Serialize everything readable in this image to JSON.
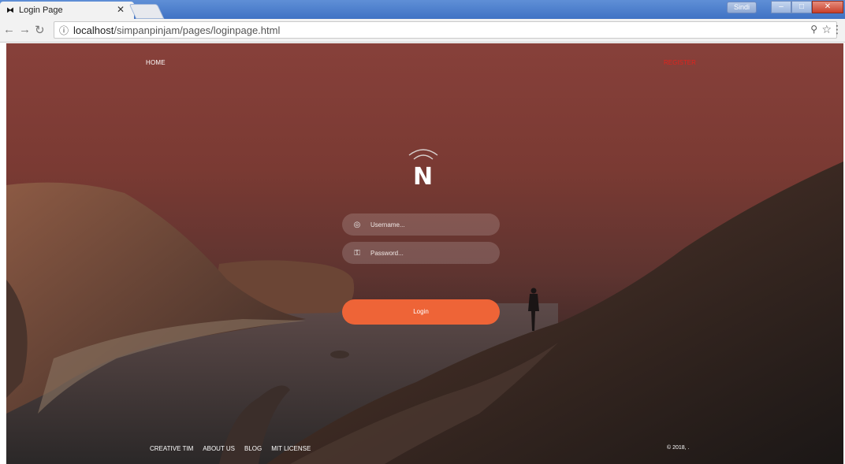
{
  "browser": {
    "tab_title": "Login Page",
    "tab_favicon": "bowtie-icon",
    "user_badge": "Sindi",
    "url_host": "localhost",
    "url_path": "/simpanpinjam/pages/loginpage.html"
  },
  "nav": {
    "home": "HOME",
    "register": "REGISTER"
  },
  "logo": {
    "letter": "N"
  },
  "form": {
    "username_placeholder": "Username...",
    "password_placeholder": "Password...",
    "login_label": "Login"
  },
  "footer": {
    "links": [
      "CREATIVE TIM",
      "ABOUT US",
      "BLOG",
      "MIT LICENSE"
    ],
    "copyright": "© 2018, ."
  },
  "colors": {
    "accent": "#ee6437",
    "register": "#e0231d"
  }
}
